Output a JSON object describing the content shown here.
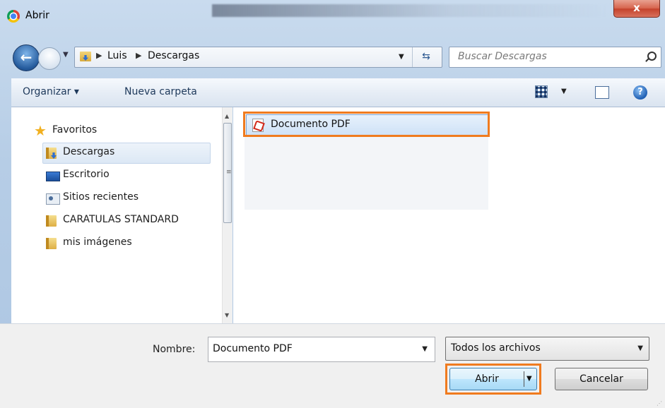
{
  "window": {
    "title": "Abrir",
    "close_label": "x"
  },
  "addressbar": {
    "crumbs": [
      "Luis",
      "Descargas"
    ]
  },
  "search": {
    "placeholder": "Buscar Descargas"
  },
  "toolbar": {
    "organize": "Organizar ▾",
    "new_folder": "Nueva carpeta",
    "help": "?"
  },
  "navpane": {
    "items": [
      {
        "label": "Favoritos",
        "icon": "star-icon"
      },
      {
        "label": "Descargas",
        "icon": "download-folder-icon",
        "selected": true
      },
      {
        "label": "Escritorio",
        "icon": "desktop-icon"
      },
      {
        "label": "Sitios recientes",
        "icon": "recent-places-icon"
      },
      {
        "label": "CARATULAS STANDARD",
        "icon": "folder-icon"
      },
      {
        "label": "mis imágenes",
        "icon": "folder-icon"
      }
    ]
  },
  "files": [
    {
      "name": "Documento PDF",
      "icon": "pdf-icon",
      "selected": true
    }
  ],
  "footer": {
    "name_label": "Nombre:",
    "name_value": "Documento PDF",
    "filetype": "Todos los archivos",
    "open_label": "Abrir",
    "cancel_label": "Cancelar"
  },
  "colors": {
    "highlight": "#f07b1f",
    "selection": "#cfe2f7"
  }
}
